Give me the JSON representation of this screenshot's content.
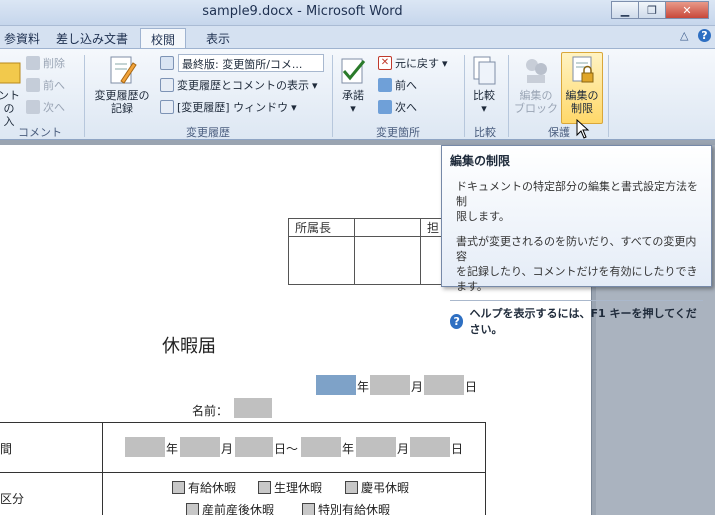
{
  "window": {
    "title": "sample9.docx - Microsoft Word",
    "minimize": "▁",
    "maximize": "❐",
    "close": "✕"
  },
  "tabs": [
    {
      "label": "参資料"
    },
    {
      "label": "差し込み文書"
    },
    {
      "label": "校閲"
    },
    {
      "label": "表示"
    }
  ],
  "tabrow": {
    "collapse": "△",
    "help": "?"
  },
  "ribbon": {
    "comment_group": {
      "label": "コメント",
      "delete": "削除",
      "prev": "前へ",
      "next": "次へ",
      "new_line1": "ント の",
      "new_line2": "入"
    },
    "tracking_group": {
      "label": "変更履歴",
      "track_line1": "変更履歴の",
      "track_line2": "記録",
      "final_dropdown": "最終版: 変更箇所/コメ...",
      "show_markup": "変更履歴とコメントの表示",
      "reviewing_pane": "[変更履歴] ウィンドウ"
    },
    "changes_group": {
      "label": "変更箇所",
      "accept": "承諾",
      "reject": "元に戻す",
      "prev": "前へ",
      "next": "次へ"
    },
    "compare_group": {
      "label": "比較",
      "compare": "比較"
    },
    "protect_group": {
      "label": "保護",
      "block_line1": "編集の",
      "block_line2": "ブロック",
      "restrict_line1": "編集の",
      "restrict_line2": "制限"
    }
  },
  "tooltip": {
    "title": "編集の制限",
    "line1": "ドキュメントの特定部分の編集と書式設定方法を制",
    "line2": "限します。",
    "line3": "書式が変更されるのを防いだり、すべての変更内容",
    "line4": "を記録したり、コメントだけを有効にしたりできます。",
    "help": "ヘルプを表示するには、F1 キーを押してください。"
  },
  "document": {
    "stamp_headers": [
      "所属長",
      "",
      "担"
    ],
    "title": "休暇届",
    "date_year": "年",
    "date_month": "月",
    "date_day": "日",
    "name_label": "名前：",
    "period_label": "間",
    "range_year": "年",
    "range_month": "月",
    "range_day_tilde": "日～",
    "range_year2": "年",
    "range_month2": "月",
    "range_day2": "日",
    "type_label": "区分",
    "types_row1": [
      "有給休暇",
      "生理休暇",
      "慶弔休暇"
    ],
    "types_row2": [
      "産前産後休暇",
      "特別有給休暇"
    ]
  }
}
